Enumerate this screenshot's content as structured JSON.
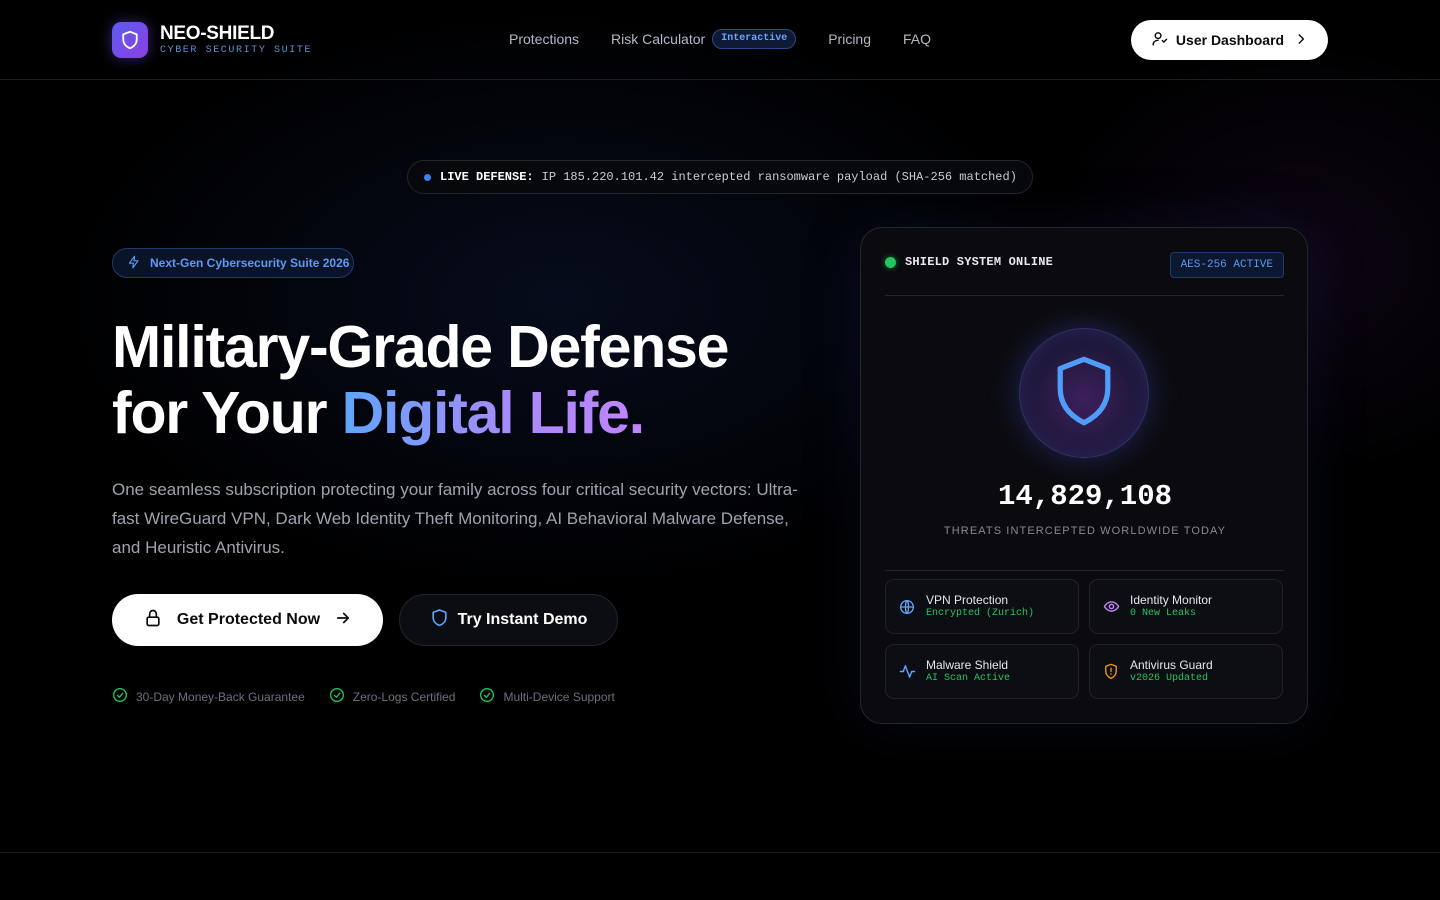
{
  "brand": {
    "name": "NEO-SHIELD",
    "tagline": "CYBER SECURITY SUITE"
  },
  "nav": {
    "links": [
      "Protections",
      "Risk Calculator",
      "Pricing",
      "FAQ"
    ],
    "calc_badge": "Interactive",
    "dashboard_label": "User Dashboard"
  },
  "ticker": {
    "label": "LIVE DEFENSE:",
    "message": "IP 185.220.101.42 intercepted ransomware payload (SHA-256 matched)"
  },
  "hero": {
    "badge": "Next-Gen Cybersecurity Suite 2026",
    "headline_line1": "Military-Grade Defense",
    "headline_line2_plain": "for Your ",
    "headline_line2_gradient": "Digital Life.",
    "lead": "One seamless subscription protecting your family across four critical security vectors: Ultra-fast WireGuard VPN, Dark Web Identity Theft Monitoring, AI Behavioral Malware Defense, and Heuristic Antivirus.",
    "cta_primary": "Get Protected Now",
    "cta_secondary": "Try Instant Demo",
    "trust": [
      "30-Day Money-Back Guarantee",
      "Zero-Logs Certified",
      "Multi-Device Support"
    ]
  },
  "status_card": {
    "status": "SHIELD SYSTEM ONLINE",
    "encryption": "AES-256 ACTIVE",
    "counter": "14,829,108",
    "counter_label": "THREATS INTERCEPTED WORLDWIDE TODAY",
    "tiles": [
      {
        "name": "VPN Protection",
        "status": "Encrypted (Zurich)",
        "icon": "globe-icon"
      },
      {
        "name": "Identity Monitor",
        "status": "0 New Leaks",
        "icon": "eye-icon"
      },
      {
        "name": "Malware Shield",
        "status": "AI Scan Active",
        "icon": "activity-icon"
      },
      {
        "name": "Antivirus Guard",
        "status": "v2026 Updated",
        "icon": "shield-alert-icon"
      }
    ]
  },
  "colors": {
    "accent_blue": "#3b82f6",
    "accent_purple": "#a78bfa",
    "status_green": "#22c55e",
    "warning_amber": "#f59e0b"
  }
}
